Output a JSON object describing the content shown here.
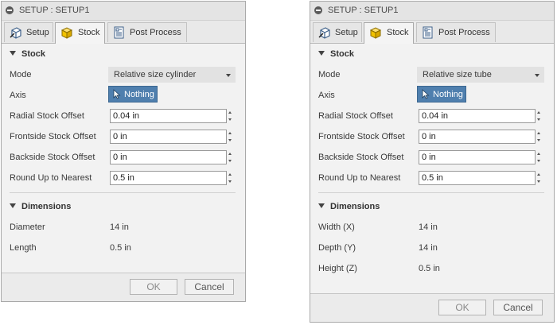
{
  "dialogs": [
    {
      "title": "SETUP : SETUP1",
      "tabs": [
        {
          "label": "Setup",
          "icon": "setup-icon"
        },
        {
          "label": "Stock",
          "icon": "stock-cube-icon"
        },
        {
          "label": "Post Process",
          "icon": "post-process-icon"
        }
      ],
      "active_tab": "Stock",
      "stock_section": "Stock",
      "mode_label": "Mode",
      "mode_value": "Relative size cylinder",
      "axis_label": "Axis",
      "axis_button": "Nothing",
      "fields": [
        {
          "label": "Radial Stock Offset",
          "value": "0.04 in"
        },
        {
          "label": "Frontside Stock Offset",
          "value": "0 in"
        },
        {
          "label": "Backside Stock Offset",
          "value": "0 in"
        },
        {
          "label": "Round Up to Nearest",
          "value": "0.5 in"
        }
      ],
      "dimensions_section": "Dimensions",
      "dimensions": [
        {
          "label": "Diameter",
          "value": "14 in"
        },
        {
          "label": "Length",
          "value": "0.5 in"
        }
      ],
      "ok_label": "OK",
      "cancel_label": "Cancel"
    },
    {
      "title": "SETUP : SETUP1",
      "tabs": [
        {
          "label": "Setup",
          "icon": "setup-icon"
        },
        {
          "label": "Stock",
          "icon": "stock-cube-icon"
        },
        {
          "label": "Post Process",
          "icon": "post-process-icon"
        }
      ],
      "active_tab": "Stock",
      "stock_section": "Stock",
      "mode_label": "Mode",
      "mode_value": "Relative size tube",
      "axis_label": "Axis",
      "axis_button": "Nothing",
      "fields": [
        {
          "label": "Radial Stock Offset",
          "value": "0.04 in"
        },
        {
          "label": "Frontside Stock Offset",
          "value": "0 in"
        },
        {
          "label": "Backside Stock Offset",
          "value": "0 in"
        },
        {
          "label": "Round Up to Nearest",
          "value": "0.5 in"
        }
      ],
      "dimensions_section": "Dimensions",
      "dimensions": [
        {
          "label": "Width (X)",
          "value": "14 in"
        },
        {
          "label": "Depth (Y)",
          "value": "14 in"
        },
        {
          "label": "Height (Z)",
          "value": "0.5 in"
        }
      ],
      "ok_label": "OK",
      "cancel_label": "Cancel"
    }
  ],
  "colors": {
    "accent": "#4f7fae",
    "panel": "#f2f2f2",
    "stock_icon": "#f2c200"
  }
}
